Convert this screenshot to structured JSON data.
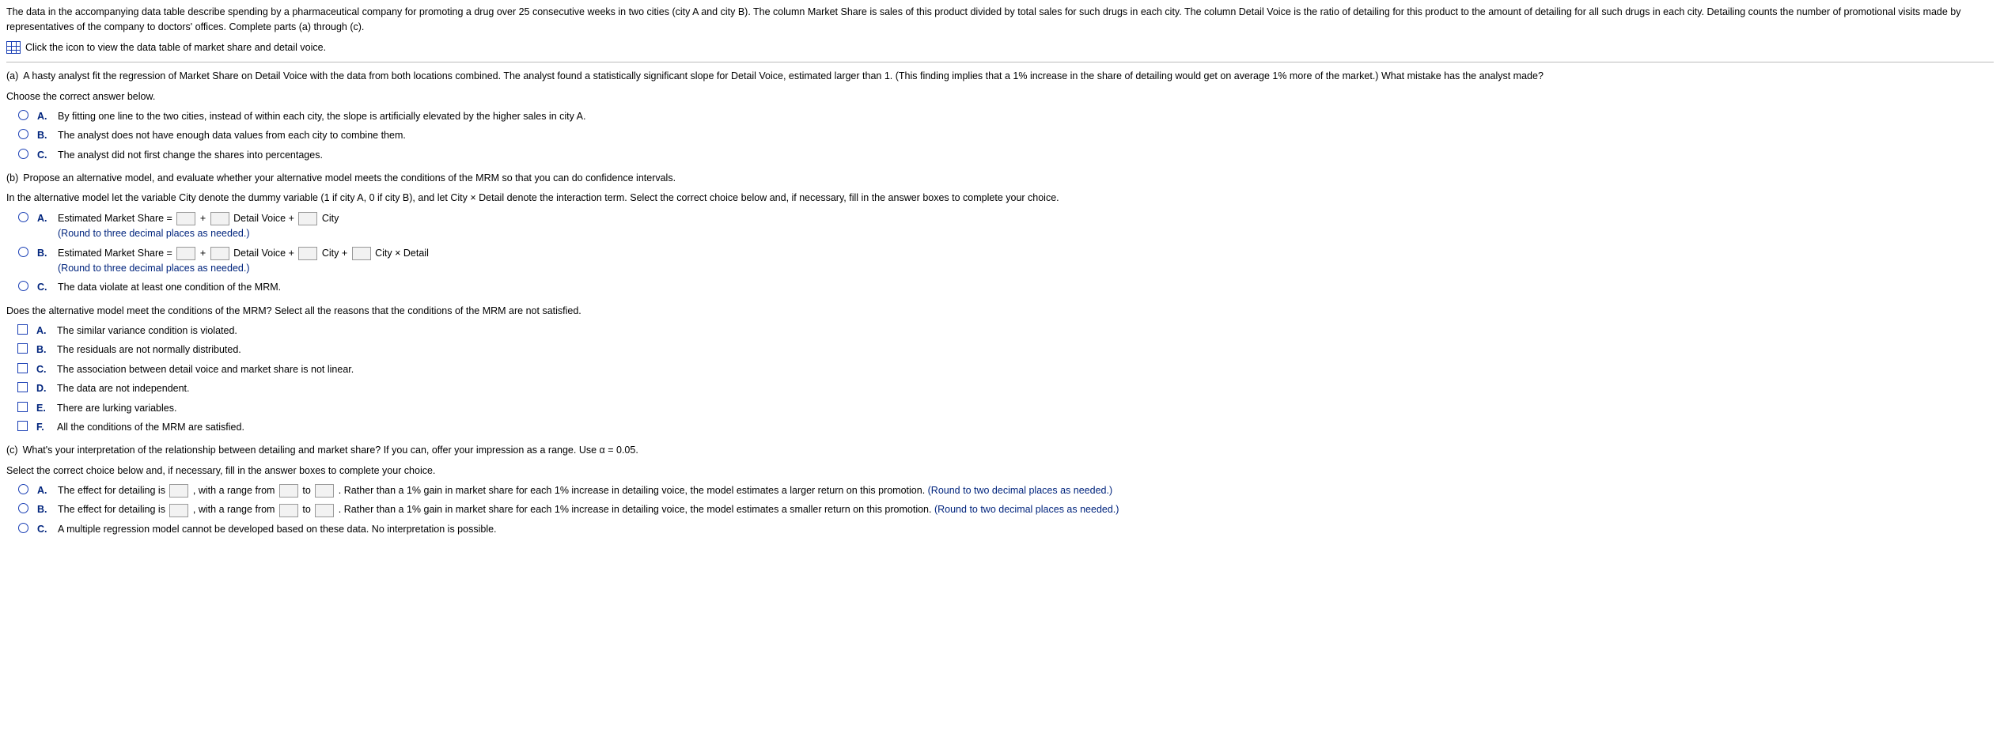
{
  "intro": {
    "p1": "The data in the accompanying data table describe spending by a pharmaceutical company for promoting a drug over 25 consecutive weeks in two cities (city A and city B). The column Market Share is sales of this product divided by total sales for such drugs in each city. The column Detail Voice is the ratio of detailing for this product to the amount of detailing for all such drugs in each city. Detailing counts the number of promotional visits made by representatives of the company to doctors' offices. Complete parts (a) through (c).",
    "iconline": "Click the icon to view the data table of market share and detail voice."
  },
  "a": {
    "label": "(a)",
    "q": "A hasty analyst fit the regression of Market Share on Detail Voice with the data from both locations combined. The analyst found a statistically significant slope for Detail Voice, estimated larger than 1. (This finding implies that a 1% increase in the share of detailing would get on average 1% more of the market.) What mistake has the analyst made?",
    "prompt": "Choose the correct answer below.",
    "A": "By fitting one line to the two cities, instead of within each city, the slope is artificially elevated by the higher sales in city A.",
    "B": "The analyst does not have enough data values from each city to combine them.",
    "C": "The analyst did not first change the shares into percentages."
  },
  "b": {
    "label": "(b)",
    "q": "Propose an alternative model, and evaluate whether your alternative model meets the conditions of the MRM so that you can do confidence intervals.",
    "prompt": "In the alternative model let the variable City denote the dummy variable (1 if city A, 0 if city B), and let City × Detail denote the interaction term. Select the correct choice below and, if necessary, fill in the answer boxes to complete your choice.",
    "A_pref": "Estimated Market Share =",
    "A_t1": " + ",
    "A_t2": " Detail Voice + ",
    "A_t3": " City",
    "B_pref": "Estimated Market Share =",
    "B_t1": " + ",
    "B_t2": " Detail Voice + ",
    "B_t3": " City + ",
    "B_t4": " City × Detail",
    "round3": "(Round to three decimal places as needed.)",
    "C": "The data violate at least one condition of the MRM.",
    "mrm_q": "Does the alternative model meet the conditions of the MRM? Select all the reasons that the conditions of the MRM are not satisfied.",
    "mA": "The similar variance condition is violated.",
    "mB": "The residuals are not normally distributed.",
    "mC": "The association between detail voice and market share is not linear.",
    "mD": "The data are not independent.",
    "mE": "There are lurking variables.",
    "mF": "All the conditions of the MRM are satisfied."
  },
  "c": {
    "label": "(c)",
    "q": "What's your interpretation of the relationship between detailing and market share? If you can, offer your impression as a range. Use α = 0.05.",
    "prompt": "Select the correct choice below and, if necessary, fill in the answer boxes to complete your choice.",
    "A_pref": "The effect for detailing is ",
    "A_mid1": ", with a range from ",
    "to": " to ",
    "A_tail": ". Rather than a 1% gain in market share for each 1% increase in detailing voice, the model estimates a larger return on this promotion. ",
    "B_pref": "The effect for detailing is ",
    "B_mid1": ", with a range from ",
    "B_tail": ". Rather than a 1% gain in market share for each 1% increase in detailing voice, the model estimates a smaller return on this promotion. ",
    "round2": "(Round to two decimal places as needed.)",
    "C": "A multiple regression model cannot be developed based on these data. No interpretation is possible."
  }
}
